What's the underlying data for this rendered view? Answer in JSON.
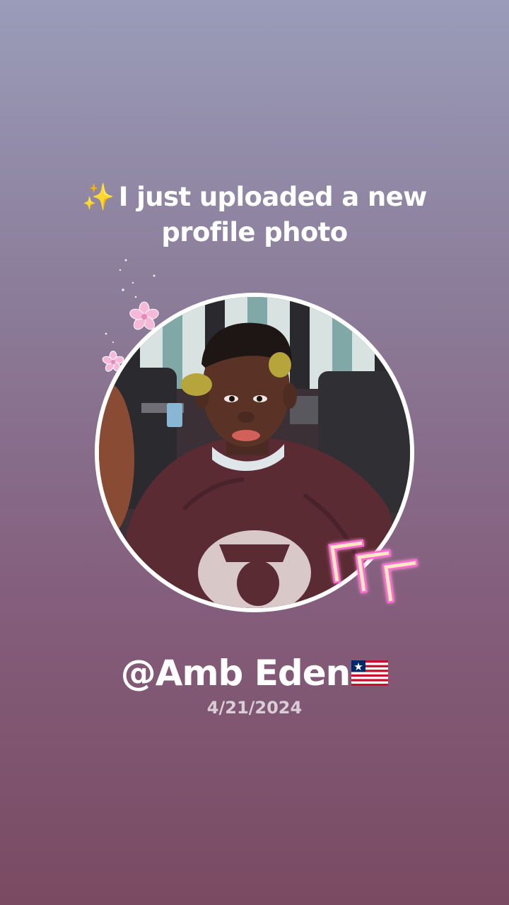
{
  "post": {
    "sparkle_icon": "✨",
    "headline_line1": "I just uploaded a new",
    "headline_line2": "profile photo",
    "username": "@Amb Eden",
    "flag_icon": "liberia-flag-icon",
    "date": "4/21/2024"
  },
  "colors": {
    "background_top": "#9a9cb9",
    "background_bottom": "#7a4a62",
    "text": "#ffffff",
    "date_text": "#d9cdd6",
    "ring": "#ffffff",
    "accent_pink": "#f6b8d8"
  }
}
